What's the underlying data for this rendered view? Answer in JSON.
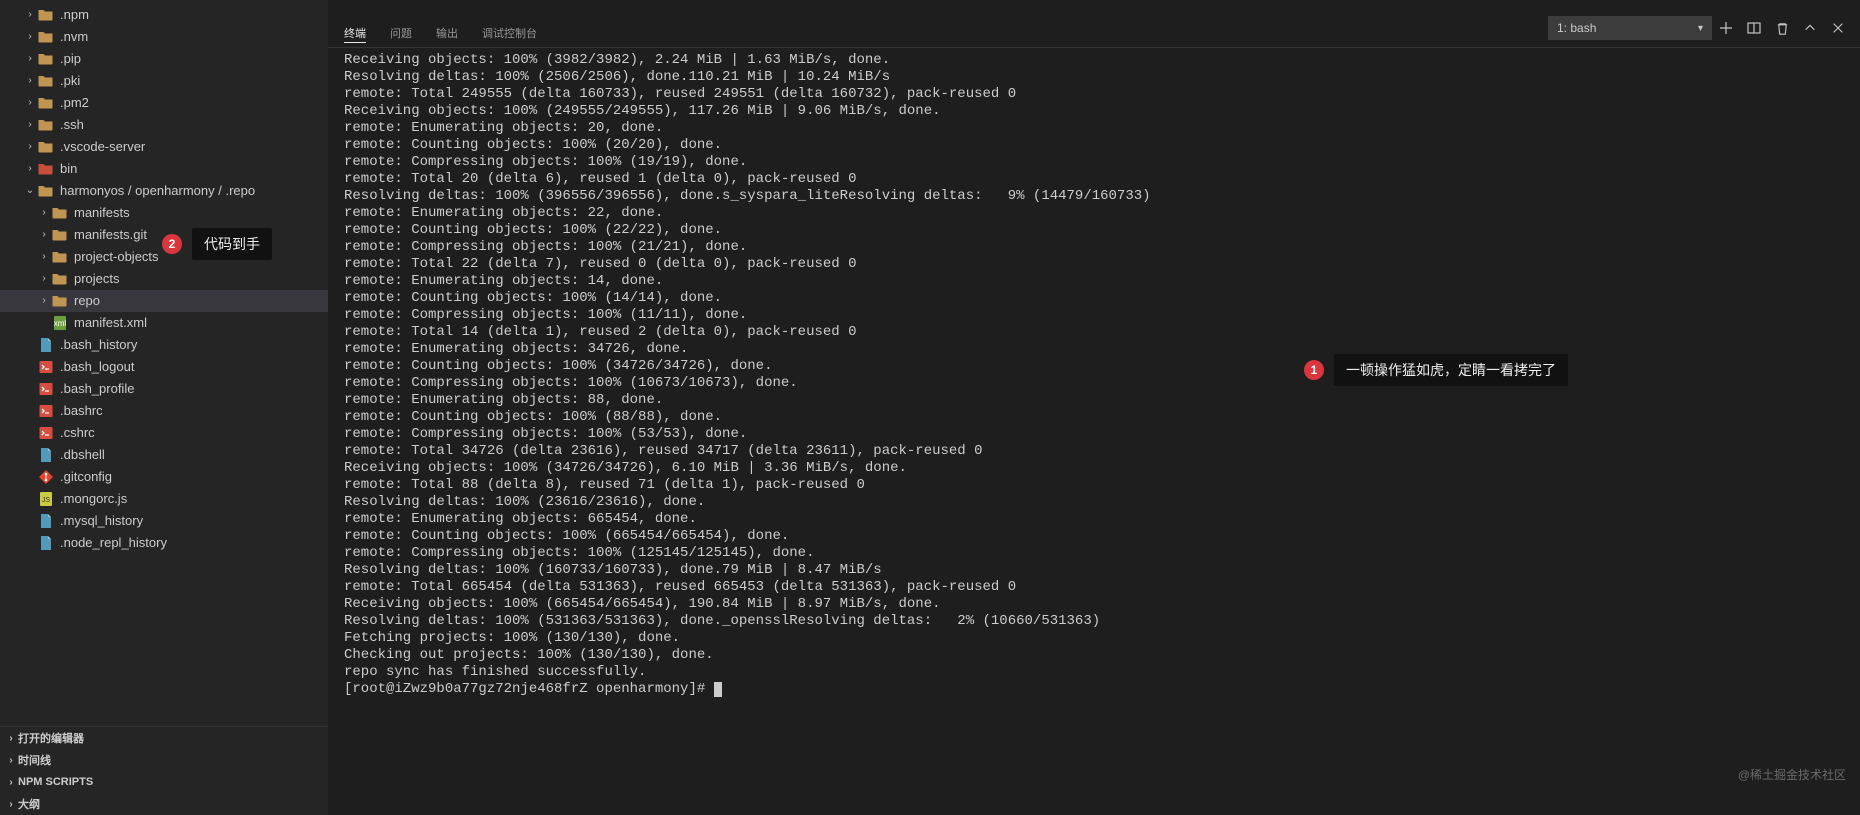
{
  "sidebar": {
    "tree": [
      {
        "depth": 1,
        "expand": "closed",
        "kind": "folder",
        "label": ".npm",
        "sel": false
      },
      {
        "depth": 1,
        "expand": "closed",
        "kind": "folder",
        "label": ".nvm",
        "sel": false
      },
      {
        "depth": 1,
        "expand": "closed",
        "kind": "folder",
        "label": ".pip",
        "sel": false
      },
      {
        "depth": 1,
        "expand": "closed",
        "kind": "folder",
        "label": ".pki",
        "sel": false
      },
      {
        "depth": 1,
        "expand": "closed",
        "kind": "folder",
        "label": ".pm2",
        "sel": false
      },
      {
        "depth": 1,
        "expand": "closed",
        "kind": "folder",
        "label": ".ssh",
        "sel": false
      },
      {
        "depth": 1,
        "expand": "closed",
        "kind": "folder",
        "label": ".vscode-server",
        "sel": false
      },
      {
        "depth": 1,
        "expand": "closed",
        "kind": "folder-red",
        "label": "bin",
        "sel": false
      },
      {
        "depth": 1,
        "expand": "open",
        "kind": "folder",
        "label": "harmonyos / openharmony / .repo",
        "sel": false
      },
      {
        "depth": 2,
        "expand": "closed",
        "kind": "folder",
        "label": "manifests",
        "sel": false
      },
      {
        "depth": 2,
        "expand": "closed",
        "kind": "folder",
        "label": "manifests.git",
        "sel": false
      },
      {
        "depth": 2,
        "expand": "closed",
        "kind": "folder",
        "label": "project-objects",
        "sel": false
      },
      {
        "depth": 2,
        "expand": "closed",
        "kind": "folder",
        "label": "projects",
        "sel": false
      },
      {
        "depth": 2,
        "expand": "closed",
        "kind": "folder",
        "label": "repo",
        "sel": true
      },
      {
        "depth": 2,
        "expand": "none",
        "kind": "xml",
        "label": "manifest.xml",
        "sel": false
      },
      {
        "depth": 1,
        "expand": "none",
        "kind": "file",
        "label": ".bash_history",
        "sel": false
      },
      {
        "depth": 1,
        "expand": "none",
        "kind": "shell",
        "label": ".bash_logout",
        "sel": false
      },
      {
        "depth": 1,
        "expand": "none",
        "kind": "shell",
        "label": ".bash_profile",
        "sel": false
      },
      {
        "depth": 1,
        "expand": "none",
        "kind": "shell",
        "label": ".bashrc",
        "sel": false
      },
      {
        "depth": 1,
        "expand": "none",
        "kind": "shell",
        "label": ".cshrc",
        "sel": false
      },
      {
        "depth": 1,
        "expand": "none",
        "kind": "file",
        "label": ".dbshell",
        "sel": false
      },
      {
        "depth": 1,
        "expand": "none",
        "kind": "git",
        "label": ".gitconfig",
        "sel": false
      },
      {
        "depth": 1,
        "expand": "none",
        "kind": "js",
        "label": ".mongorc.js",
        "sel": false
      },
      {
        "depth": 1,
        "expand": "none",
        "kind": "file",
        "label": ".mysql_history",
        "sel": false
      },
      {
        "depth": 1,
        "expand": "none",
        "kind": "file",
        "label": ".node_repl_history",
        "sel": false
      }
    ],
    "sections": [
      {
        "label": "打开的编辑器"
      },
      {
        "label": "时间线"
      },
      {
        "label": "NPM SCRIPTS"
      },
      {
        "label": "大纲"
      }
    ]
  },
  "panel": {
    "tabs": [
      "终端",
      "问题",
      "输出",
      "调试控制台"
    ],
    "active_tab_index": 0,
    "selector_label": "1: bash",
    "terminal_lines": [
      "Receiving objects: 100% (3982/3982), 2.24 MiB | 1.63 MiB/s, done.",
      "Resolving deltas: 100% (2506/2506), done.110.21 MiB | 10.24 MiB/s",
      "remote: Total 249555 (delta 160733), reused 249551 (delta 160732), pack-reused 0",
      "Receiving objects: 100% (249555/249555), 117.26 MiB | 9.06 MiB/s, done.",
      "remote: Enumerating objects: 20, done.",
      "remote: Counting objects: 100% (20/20), done.",
      "remote: Compressing objects: 100% (19/19), done.",
      "remote: Total 20 (delta 6), reused 1 (delta 0), pack-reused 0",
      "Resolving deltas: 100% (396556/396556), done.s_syspara_liteResolving deltas:   9% (14479/160733)",
      "remote: Enumerating objects: 22, done.",
      "remote: Counting objects: 100% (22/22), done.",
      "remote: Compressing objects: 100% (21/21), done.",
      "remote: Total 22 (delta 7), reused 0 (delta 0), pack-reused 0",
      "remote: Enumerating objects: 14, done.",
      "remote: Counting objects: 100% (14/14), done.",
      "remote: Compressing objects: 100% (11/11), done.",
      "remote: Total 14 (delta 1), reused 2 (delta 0), pack-reused 0",
      "remote: Enumerating objects: 34726, done.",
      "remote: Counting objects: 100% (34726/34726), done.",
      "remote: Compressing objects: 100% (10673/10673), done.",
      "remote: Enumerating objects: 88, done.",
      "remote: Counting objects: 100% (88/88), done.",
      "remote: Compressing objects: 100% (53/53), done.",
      "remote: Total 34726 (delta 23616), reused 34717 (delta 23611), pack-reused 0",
      "Receiving objects: 100% (34726/34726), 6.10 MiB | 3.36 MiB/s, done.",
      "remote: Total 88 (delta 8), reused 71 (delta 1), pack-reused 0",
      "Resolving deltas: 100% (23616/23616), done.",
      "remote: Enumerating objects: 665454, done.",
      "remote: Counting objects: 100% (665454/665454), done.",
      "remote: Compressing objects: 100% (125145/125145), done.",
      "Resolving deltas: 100% (160733/160733), done.79 MiB | 8.47 MiB/s",
      "remote: Total 665454 (delta 531363), reused 665453 (delta 531363), pack-reused 0",
      "Receiving objects: 100% (665454/665454), 190.84 MiB | 8.97 MiB/s, done.",
      "Resolving deltas: 100% (531363/531363), done._opensslResolving deltas:   2% (10660/531363)",
      "Fetching projects: 100% (130/130), done.",
      "Checking out projects: 100% (130/130), done.",
      "repo sync has finished successfully."
    ],
    "prompt": "[root@iZwz9b0a77gz72nje468frZ openharmony]# "
  },
  "annotations": {
    "a1": {
      "num": "1",
      "text": "一顿操作猛如虎，定睛一看拷完了"
    },
    "a2": {
      "num": "2",
      "text": "代码到手"
    }
  },
  "watermark": "@稀土掘金技术社区"
}
